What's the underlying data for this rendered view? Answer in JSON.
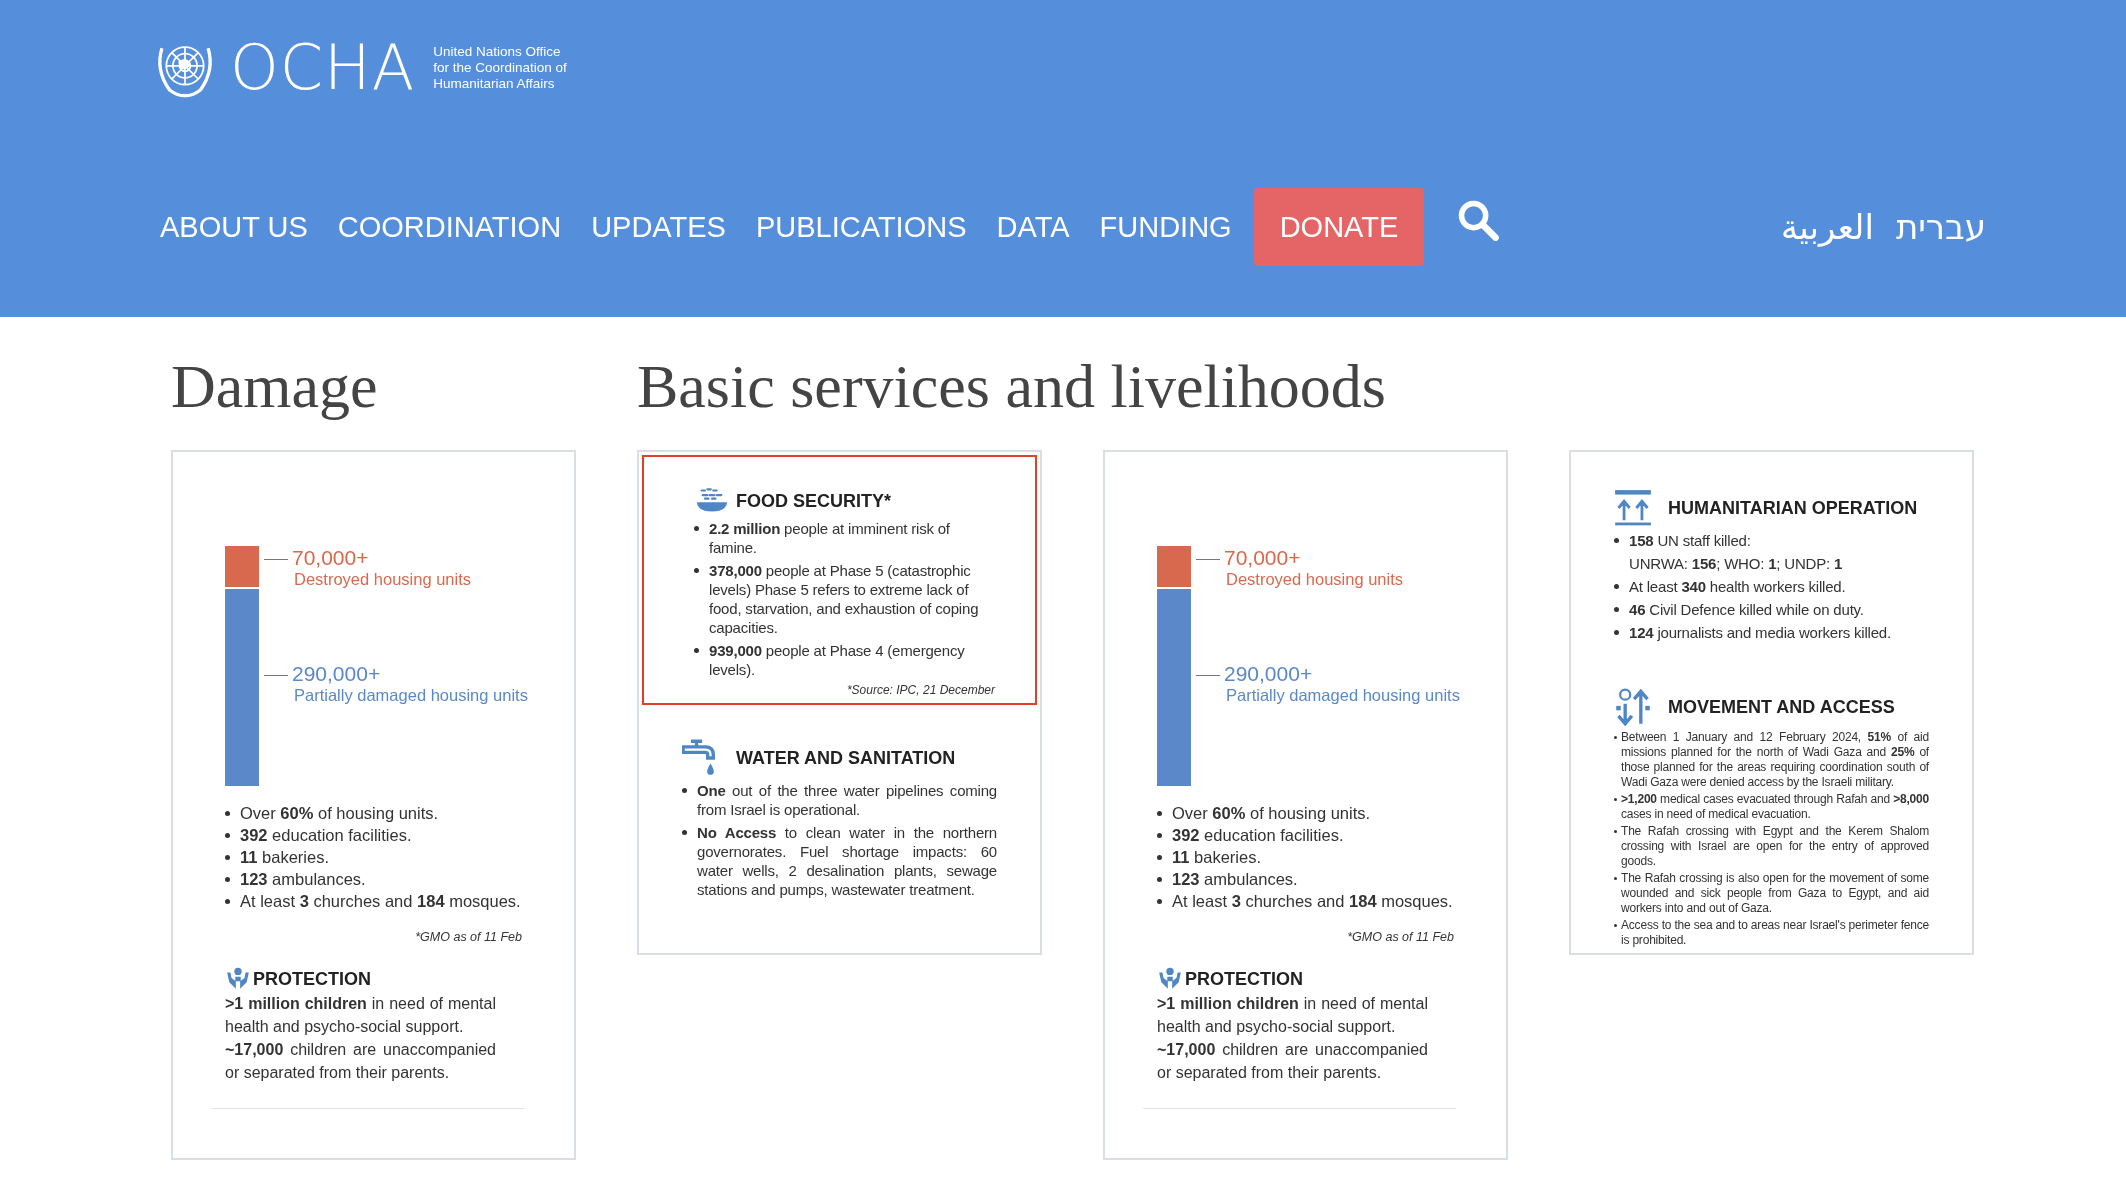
{
  "header": {
    "logo": {
      "wordmark": "OCHA",
      "tagline": [
        "United Nations Office",
        "for the Coordination of",
        "Humanitarian Affairs"
      ]
    },
    "nav": [
      {
        "label": "ABOUT US",
        "kind": "link"
      },
      {
        "label": "COORDINATION",
        "kind": "link"
      },
      {
        "label": "UPDATES",
        "kind": "link"
      },
      {
        "label": "PUBLICATIONS",
        "kind": "link"
      },
      {
        "label": "DATA",
        "kind": "link"
      },
      {
        "label": "FUNDING",
        "kind": "link"
      },
      {
        "label": "DONATE",
        "kind": "button"
      }
    ],
    "languages": [
      "עברית",
      "العربية"
    ]
  },
  "sections": [
    {
      "title": "Damage"
    },
    {
      "title": "Basic services and livelihoods"
    }
  ],
  "cards": [
    {
      "kind": "damage",
      "destroyed": {
        "value": "70,000+",
        "label": "Destroyed housing units"
      },
      "damaged": {
        "value": "290,000+",
        "label": "Partially damaged housing units"
      },
      "facts": [
        "Over **60%** of housing units.",
        "**392** education facilities.",
        "**11** bakeries.",
        "**123** ambulances.",
        "At least **3** churches and **184** mosques."
      ],
      "note": "*GMO as of 11 Feb",
      "protection": {
        "title": "PROTECTION",
        "paragraphs": [
          "**>1 million children** in need of mental health and psycho-social support.",
          "**~17,000** children are unaccompanied or separated from their parents."
        ]
      }
    },
    {
      "kind": "blocks",
      "blocks": [
        {
          "title": "FOOD SECURITY*",
          "highlighted": true,
          "items": [
            {
              "text": "**2.2 million** people at imminent risk of famine.",
              "bullet": true
            },
            {
              "text": "**378,000** people at Phase 5 (catastrophic levels) Phase 5 refers to extreme lack of food, starvation, and exhaustion of coping capacities.",
              "bullet": true
            },
            {
              "text": "**939,000** people at Phase 4 (emergency levels).",
              "bullet": true
            }
          ],
          "source": "*Source:  IPC, 21 December"
        },
        {
          "title": "WATER AND SANITATION",
          "highlighted": false,
          "items": [
            {
              "text": "**One** out of the three water pipelines coming from Israel is operational.",
              "bullet": true
            },
            {
              "text": "**No Access** to clean water in the northern governorates. Fuel shortage impacts: 60 water wells, 2 desalination plants, sewage stations and pumps, wastewater treatment.",
              "bullet": true
            }
          ]
        }
      ]
    },
    {
      "kind": "damage",
      "destroyed": {
        "value": "70,000+",
        "label": "Destroyed housing units"
      },
      "damaged": {
        "value": "290,000+",
        "label": "Partially damaged housing units"
      },
      "facts": [
        "Over **60%** of housing units.",
        "**392** education facilities.",
        "**11** bakeries.",
        "**123** ambulances.",
        "At least **3** churches and **184** mosques."
      ],
      "note": "*GMO as of 11 Feb",
      "protection": {
        "title": "PROTECTION",
        "paragraphs": [
          "**>1 million children** in need of mental health and psycho-social support.",
          "**~17,000** children are unaccompanied or separated from their parents."
        ]
      }
    },
    {
      "kind": "blocks",
      "blocks": [
        {
          "title": "HUMANITARIAN OPERATION",
          "highlighted": false,
          "items": [
            {
              "text": "**158** UN staff killed:",
              "bullet": true
            },
            {
              "text": "UNRWA: **156**; WHO: **1**; UNDP: **1**",
              "bullet": false
            },
            {
              "text": "At least **340** health workers killed.",
              "bullet": true
            },
            {
              "text": "**46** Civil Defence killed while on duty.",
              "bullet": true
            },
            {
              "text": "**124** journalists and media workers killed.",
              "bullet": true
            }
          ]
        },
        {
          "title": "MOVEMENT AND ACCESS",
          "highlighted": false,
          "items": [
            {
              "text": "Between 1 January and 12 February 2024, **51%** of aid missions planned for the north of Wadi Gaza and **25%** of those planned for the areas requiring coordination south of Wadi Gaza were denied access by the Israeli military.",
              "bullet": true
            },
            {
              "text": "**>1,200** medical cases evacuated through Rafah and **>8,000** cases in need of medical evacuation.",
              "bullet": true
            },
            {
              "text": "The Rafah crossing with Egypt and the Kerem Shalom crossing with Israel are open for the entry of approved goods.",
              "bullet": true
            },
            {
              "text": "The Rafah crossing is also open for the movement of some wounded and sick people from Gaza to Egypt, and aid workers into and out of Gaza.",
              "bullet": true
            },
            {
              "text": "Access to the sea and to areas near Israel's perimeter fence is prohibited.",
              "bullet": true
            }
          ]
        }
      ]
    }
  ]
}
